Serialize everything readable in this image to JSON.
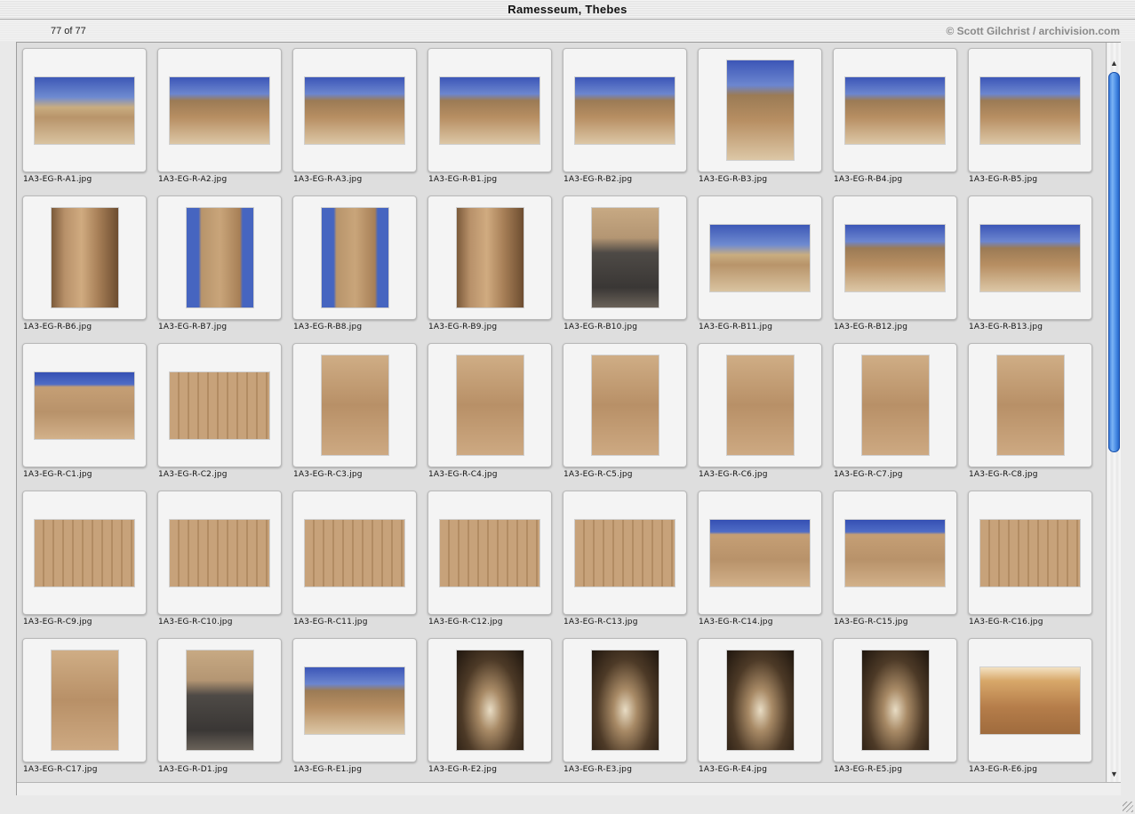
{
  "window": {
    "title": "Ramesseum, Thebes"
  },
  "info": {
    "count": "77 of 77",
    "credit": "© Scott Gilchrist / archivision.com"
  },
  "thumbnails": [
    {
      "file": "1A3-EG-R-A1.jpg",
      "orient": "land",
      "tone": "sky-desert"
    },
    {
      "file": "1A3-EG-R-A2.jpg",
      "orient": "land",
      "tone": "sky-ruin"
    },
    {
      "file": "1A3-EG-R-A3.jpg",
      "orient": "land",
      "tone": "sky-ruin"
    },
    {
      "file": "1A3-EG-R-B1.jpg",
      "orient": "land",
      "tone": "sky-ruin"
    },
    {
      "file": "1A3-EG-R-B2.jpg",
      "orient": "land",
      "tone": "sky-ruin"
    },
    {
      "file": "1A3-EG-R-B3.jpg",
      "orient": "port",
      "tone": "sky-ruin"
    },
    {
      "file": "1A3-EG-R-B4.jpg",
      "orient": "land",
      "tone": "sky-ruin"
    },
    {
      "file": "1A3-EG-R-B5.jpg",
      "orient": "land",
      "tone": "sky-ruin"
    },
    {
      "file": "1A3-EG-R-B6.jpg",
      "orient": "port",
      "tone": "pillar"
    },
    {
      "file": "1A3-EG-R-B7.jpg",
      "orient": "port",
      "tone": "sky-statue"
    },
    {
      "file": "1A3-EG-R-B8.jpg",
      "orient": "port",
      "tone": "sky-statue"
    },
    {
      "file": "1A3-EG-R-B9.jpg",
      "orient": "port",
      "tone": "pillar"
    },
    {
      "file": "1A3-EG-R-B10.jpg",
      "orient": "port",
      "tone": "statue-dark"
    },
    {
      "file": "1A3-EG-R-B11.jpg",
      "orient": "land",
      "tone": "sky-desert"
    },
    {
      "file": "1A3-EG-R-B12.jpg",
      "orient": "land",
      "tone": "sky-ruin"
    },
    {
      "file": "1A3-EG-R-B13.jpg",
      "orient": "land",
      "tone": "sky-ruin"
    },
    {
      "file": "1A3-EG-R-C1.jpg",
      "orient": "land",
      "tone": "sky-relief"
    },
    {
      "file": "1A3-EG-R-C2.jpg",
      "orient": "land",
      "tone": "relief"
    },
    {
      "file": "1A3-EG-R-C3.jpg",
      "orient": "port",
      "tone": "relief2"
    },
    {
      "file": "1A3-EG-R-C4.jpg",
      "orient": "port",
      "tone": "relief2"
    },
    {
      "file": "1A3-EG-R-C5.jpg",
      "orient": "port",
      "tone": "relief2"
    },
    {
      "file": "1A3-EG-R-C6.jpg",
      "orient": "port",
      "tone": "relief2"
    },
    {
      "file": "1A3-EG-R-C7.jpg",
      "orient": "port",
      "tone": "relief2"
    },
    {
      "file": "1A3-EG-R-C8.jpg",
      "orient": "port",
      "tone": "relief2"
    },
    {
      "file": "1A3-EG-R-C9.jpg",
      "orient": "land",
      "tone": "relief"
    },
    {
      "file": "1A3-EG-R-C10.jpg",
      "orient": "land",
      "tone": "relief"
    },
    {
      "file": "1A3-EG-R-C11.jpg",
      "orient": "land",
      "tone": "relief"
    },
    {
      "file": "1A3-EG-R-C12.jpg",
      "orient": "land",
      "tone": "relief"
    },
    {
      "file": "1A3-EG-R-C13.jpg",
      "orient": "land",
      "tone": "relief"
    },
    {
      "file": "1A3-EG-R-C14.jpg",
      "orient": "land",
      "tone": "sky-relief"
    },
    {
      "file": "1A3-EG-R-C15.jpg",
      "orient": "land",
      "tone": "sky-relief"
    },
    {
      "file": "1A3-EG-R-C16.jpg",
      "orient": "land",
      "tone": "relief"
    },
    {
      "file": "1A3-EG-R-C17.jpg",
      "orient": "port",
      "tone": "relief2"
    },
    {
      "file": "1A3-EG-R-D1.jpg",
      "orient": "port",
      "tone": "statue-dark"
    },
    {
      "file": "1A3-EG-R-E1.jpg",
      "orient": "land",
      "tone": "sky-ruin"
    },
    {
      "file": "1A3-EG-R-E2.jpg",
      "orient": "port",
      "tone": "dark-hall"
    },
    {
      "file": "1A3-EG-R-E3.jpg",
      "orient": "port",
      "tone": "dark-hall"
    },
    {
      "file": "1A3-EG-R-E4.jpg",
      "orient": "port",
      "tone": "dark-hall"
    },
    {
      "file": "1A3-EG-R-E5.jpg",
      "orient": "port",
      "tone": "dark-hall"
    },
    {
      "file": "1A3-EG-R-E6.jpg",
      "orient": "land",
      "tone": "warm-room"
    }
  ],
  "scrollbar": {
    "position": 0.0,
    "up_arrow": "▲",
    "down_arrow": "▼"
  }
}
